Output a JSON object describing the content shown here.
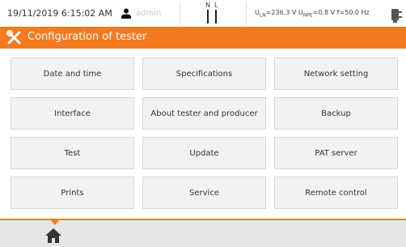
{
  "status": {
    "datetime": "19/11/2019 6:15:02 AM",
    "user": "admin",
    "socket_labels": {
      "n": "N",
      "l": "L"
    }
  },
  "title": {
    "text": "Configuration of tester"
  },
  "menu": [
    {
      "label": "Date and time"
    },
    {
      "label": "Specifications"
    },
    {
      "label": "Network setting"
    },
    {
      "label": "Interface"
    },
    {
      "label": "About tester and producer"
    },
    {
      "label": "Backup"
    },
    {
      "label": "Test"
    },
    {
      "label": "Update"
    },
    {
      "label": "PAT server"
    },
    {
      "label": "Prints"
    },
    {
      "label": "Service"
    },
    {
      "label": "Remote control"
    }
  ],
  "colors": {
    "accent": "#f47a20",
    "button_bg": "#f2f2f2",
    "bottom_bar": "#e6e6e6"
  },
  "icons": {
    "user": "user-icon",
    "socket": "socket-icon",
    "plug": "plug-icon",
    "tools": "tools-icon",
    "home": "home-icon"
  }
}
